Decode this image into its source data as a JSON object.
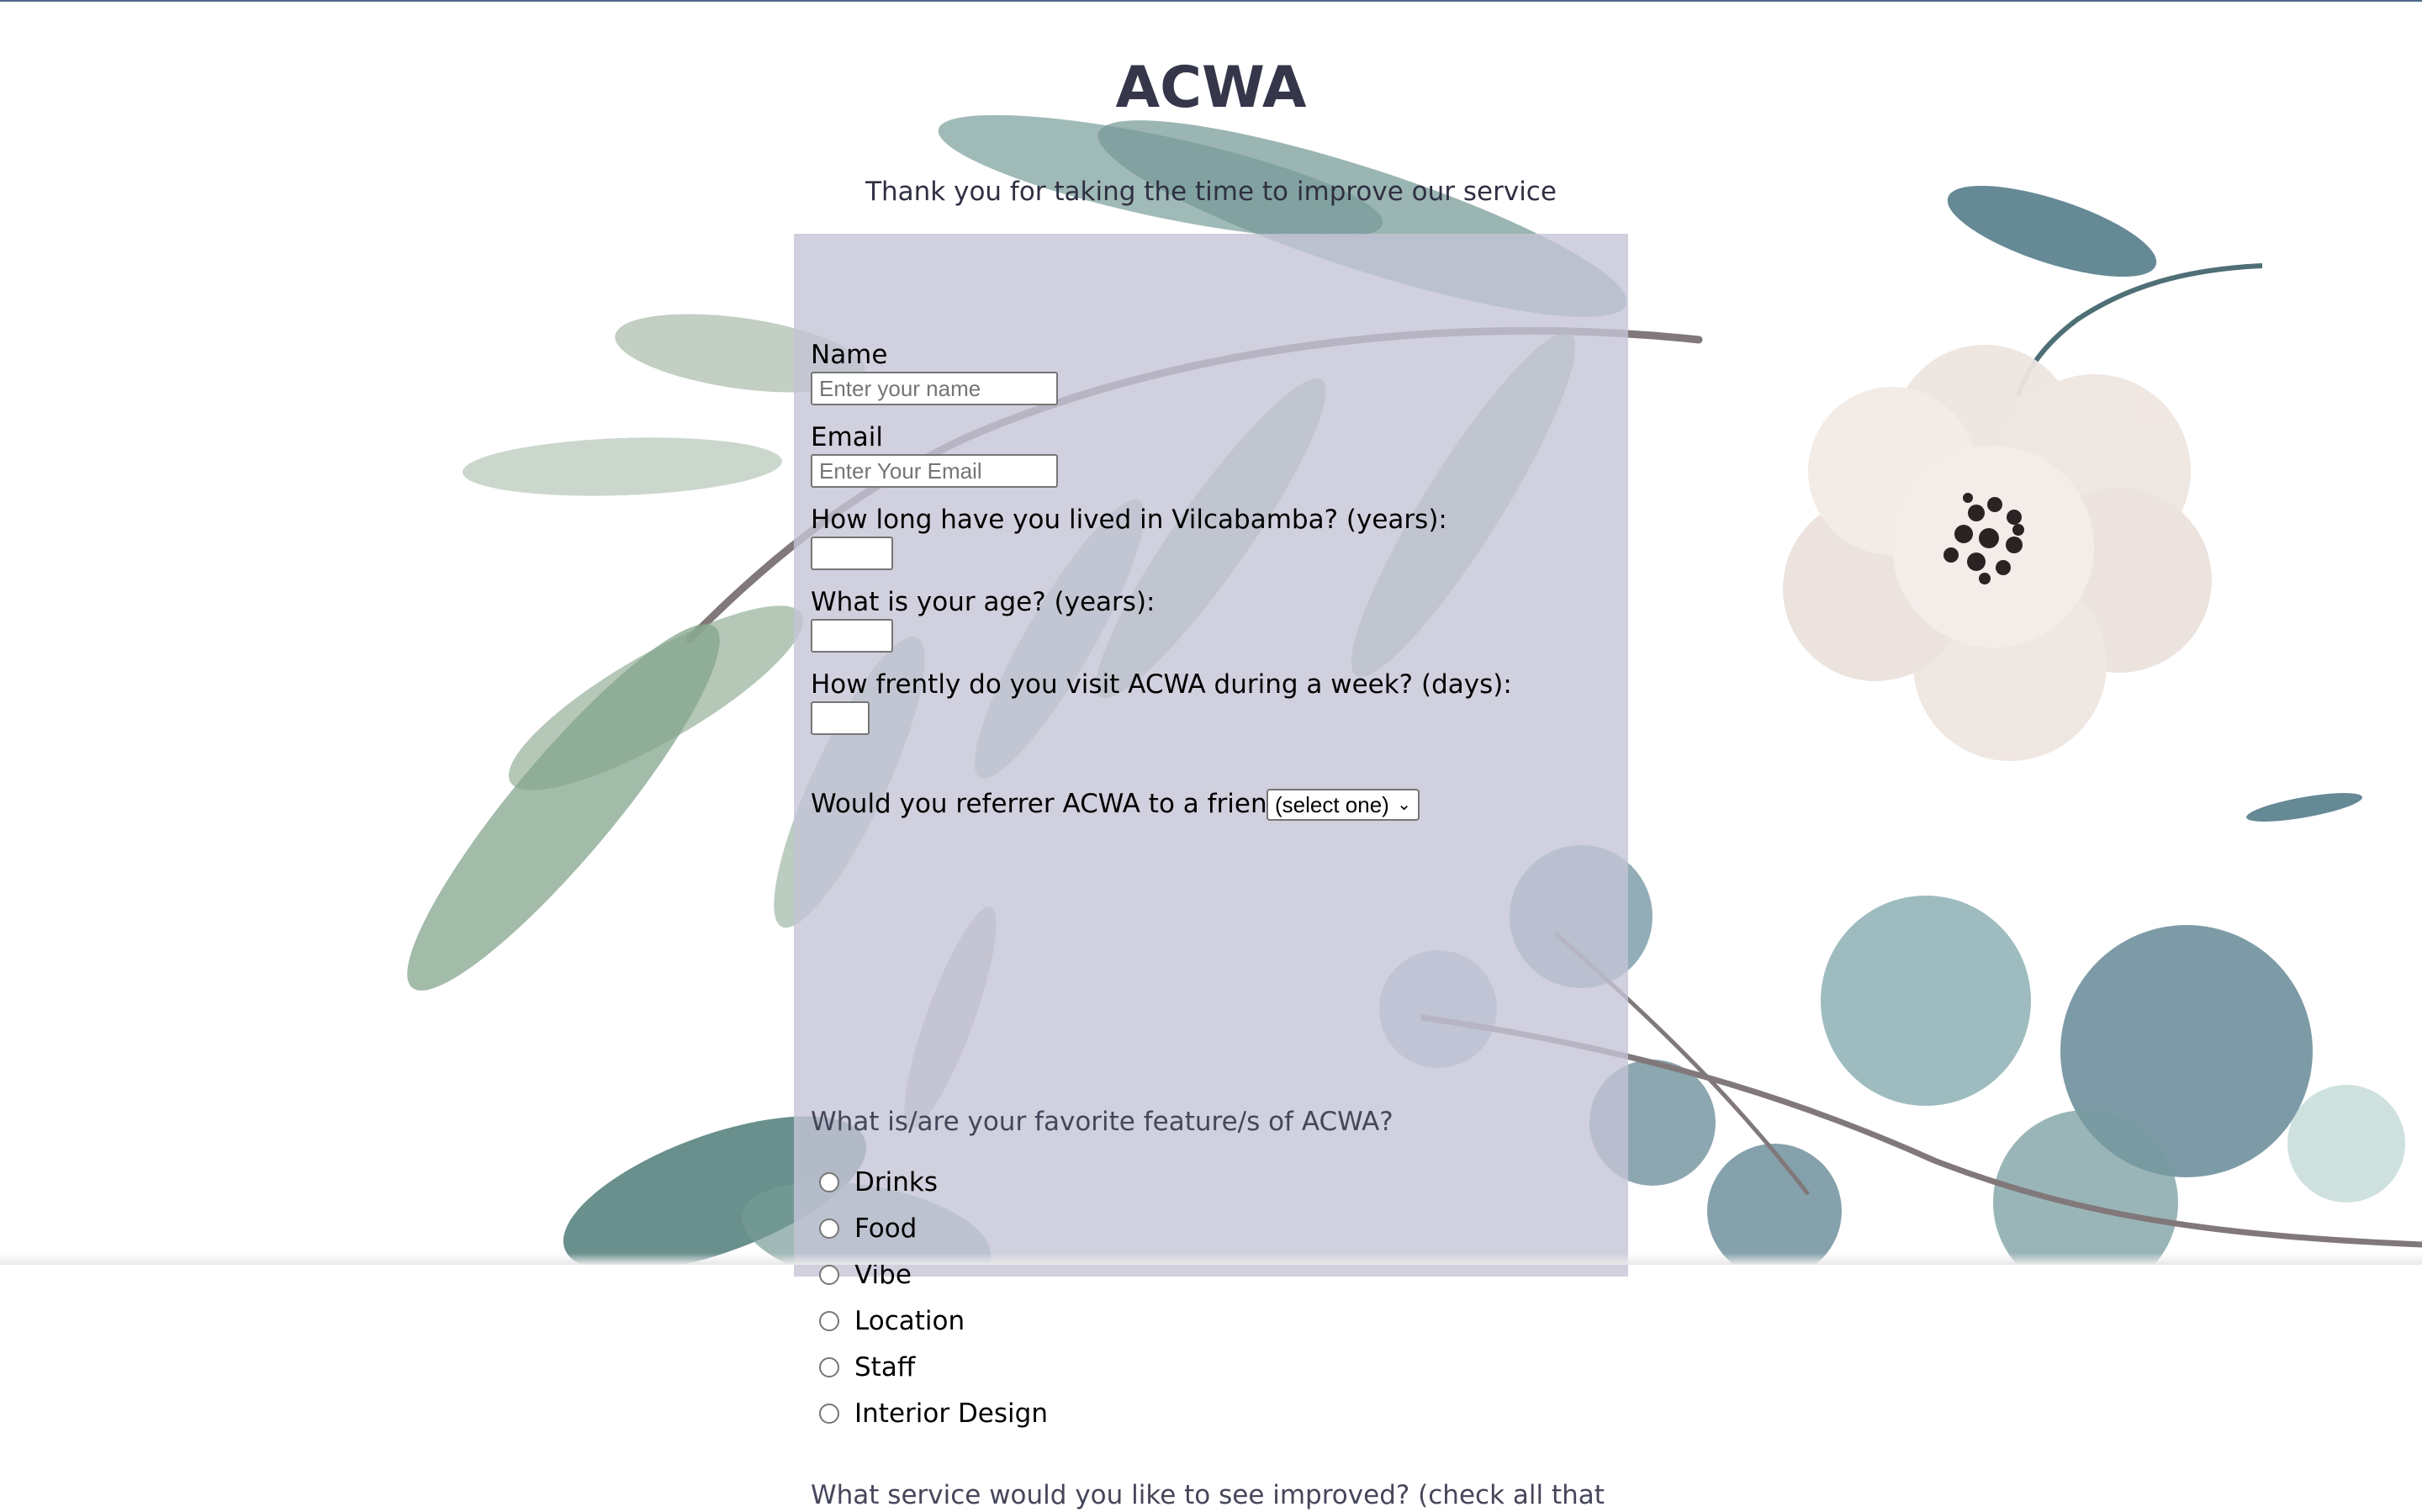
{
  "page": {
    "title": "ACWA",
    "subtitle": "Thank you for taking the time to improve our service"
  },
  "form": {
    "name": {
      "label": "Name",
      "placeholder": "Enter your name",
      "value": ""
    },
    "email": {
      "label": "Email",
      "placeholder": "Enter Your Email",
      "value": ""
    },
    "years_lived": {
      "label": "How long have you lived in Vilcabamba? (years):",
      "value": ""
    },
    "age": {
      "label": "What is your age? (years):",
      "value": ""
    },
    "visit_frequency": {
      "label": "How frently do you visit ACWA during a week? (days):",
      "value": ""
    },
    "referral": {
      "label": "Would you referrer ACWA to a friend?",
      "selected": "(select one)"
    },
    "favorite_features": {
      "question": "What is/are your favorite feature/s of ACWA?",
      "options": [
        "Drinks",
        "Food",
        "Vibe",
        "Location",
        "Staff",
        "Interior Design"
      ]
    },
    "improvements_question": "What service would you like to see improved? (check all that"
  },
  "colors": {
    "title": "#35364a",
    "panel": "#c4c4d6",
    "question_text": "#45465a",
    "leaf_green": "#6e9478",
    "leaf_teal": "#3f6b7a",
    "stem": "#6b6062",
    "flower_petal": "#f1e7e2",
    "flower_center": "#2b2224"
  }
}
